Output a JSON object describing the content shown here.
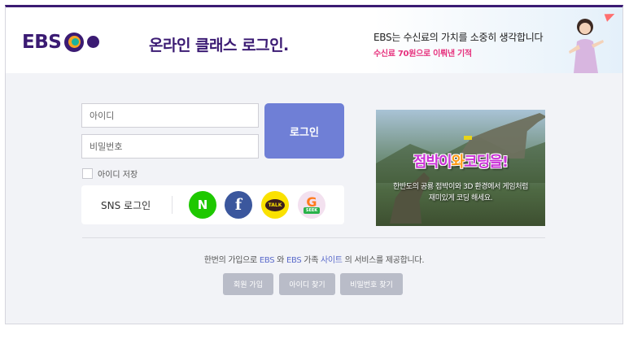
{
  "header": {
    "logo_text": "EBS",
    "page_title": "온라인 클래스 로그인.",
    "banner": {
      "line1": "EBS는 수신료의 가치를 소중히 생각합니다",
      "line2": "수신료 70원으로 이뤄낸 기적"
    }
  },
  "login": {
    "id_placeholder": "아이디",
    "password_placeholder": "비밀번호",
    "login_button": "로그인",
    "remember_label": "아이디 저장"
  },
  "sns": {
    "label": "SNS 로그인",
    "buttons": [
      {
        "name": "naver",
        "glyph": "N",
        "color": "#1ec800"
      },
      {
        "name": "facebook",
        "glyph": "f",
        "color": "#3b579d"
      },
      {
        "name": "kakao",
        "glyph": "TALK",
        "color": "#fae100"
      },
      {
        "name": "gseek",
        "glyph": "G",
        "tag": "SEEK",
        "color": "#ff7a1c"
      }
    ]
  },
  "promo": {
    "title_part1": "점박이",
    "title_part2": "와",
    "title_part3": "코딩을!",
    "sub1": "한반도의 공룡 점박이와 3D 환경에서 게임처럼",
    "sub2": "재미있게 코딩 해세요."
  },
  "footer": {
    "info_prefix": "한번의 가입으로 ",
    "info_link1": "EBS",
    "info_mid1": " 와 ",
    "info_link2": "EBS",
    "info_mid2": " 가족 ",
    "info_link3": "사이트",
    "info_suffix": " 의 서비스를 제공합니다.",
    "signup_button": "회원 가입",
    "find_id_button": "아이디 찾기",
    "find_password_button": "비밀번호 찾기"
  },
  "colors": {
    "brand_purple": "#3b1b73",
    "login_button": "#6f7fd6",
    "sub_button": "#b9bcc8",
    "highlight_pink": "#e6317d"
  }
}
